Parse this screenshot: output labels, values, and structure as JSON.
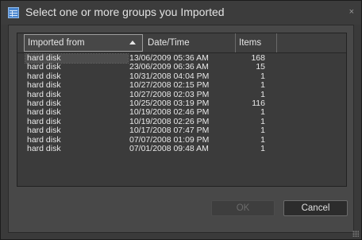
{
  "window": {
    "title": "Select one or more groups you Imported",
    "close_glyph": "×"
  },
  "columns": [
    {
      "label": "Imported from"
    },
    {
      "label": "Date/Time"
    },
    {
      "label": "Items"
    },
    {
      "label": ""
    }
  ],
  "sort": {
    "column": "Imported from",
    "direction": "ascending"
  },
  "rows": [
    {
      "source": "hard disk",
      "datetime": "13/06/2009 05:36 AM",
      "items": "168"
    },
    {
      "source": "hard disk",
      "datetime": "23/06/2009 06:36 AM",
      "items": "15"
    },
    {
      "source": "hard disk",
      "datetime": "10/31/2008 04:04 PM",
      "items": "1"
    },
    {
      "source": "hard disk",
      "datetime": "10/27/2008 02:15 PM",
      "items": "1"
    },
    {
      "source": "hard disk",
      "datetime": "10/27/2008 02:03 PM",
      "items": "1"
    },
    {
      "source": "hard disk",
      "datetime": "10/25/2008 03:19 PM",
      "items": "116"
    },
    {
      "source": "hard disk",
      "datetime": "10/19/2008 02:46 PM",
      "items": "1"
    },
    {
      "source": "hard disk",
      "datetime": "10/19/2008 02:26 PM",
      "items": "1"
    },
    {
      "source": "hard disk",
      "datetime": "10/17/2008 07:47 PM",
      "items": "1"
    },
    {
      "source": "hard disk",
      "datetime": "07/07/2008 01:09 PM",
      "items": "1"
    },
    {
      "source": "hard disk",
      "datetime": "07/01/2008 09:48 AM",
      "items": "1"
    }
  ],
  "buttons": {
    "ok_label": "OK",
    "ok_enabled": false,
    "cancel_label": "Cancel"
  },
  "colors": {
    "background": "#3a3a3a",
    "panel": "#484848",
    "text": "#e8e8e8",
    "disabled_text": "#6b6b6b",
    "icon_accent": "#4a86cf"
  }
}
